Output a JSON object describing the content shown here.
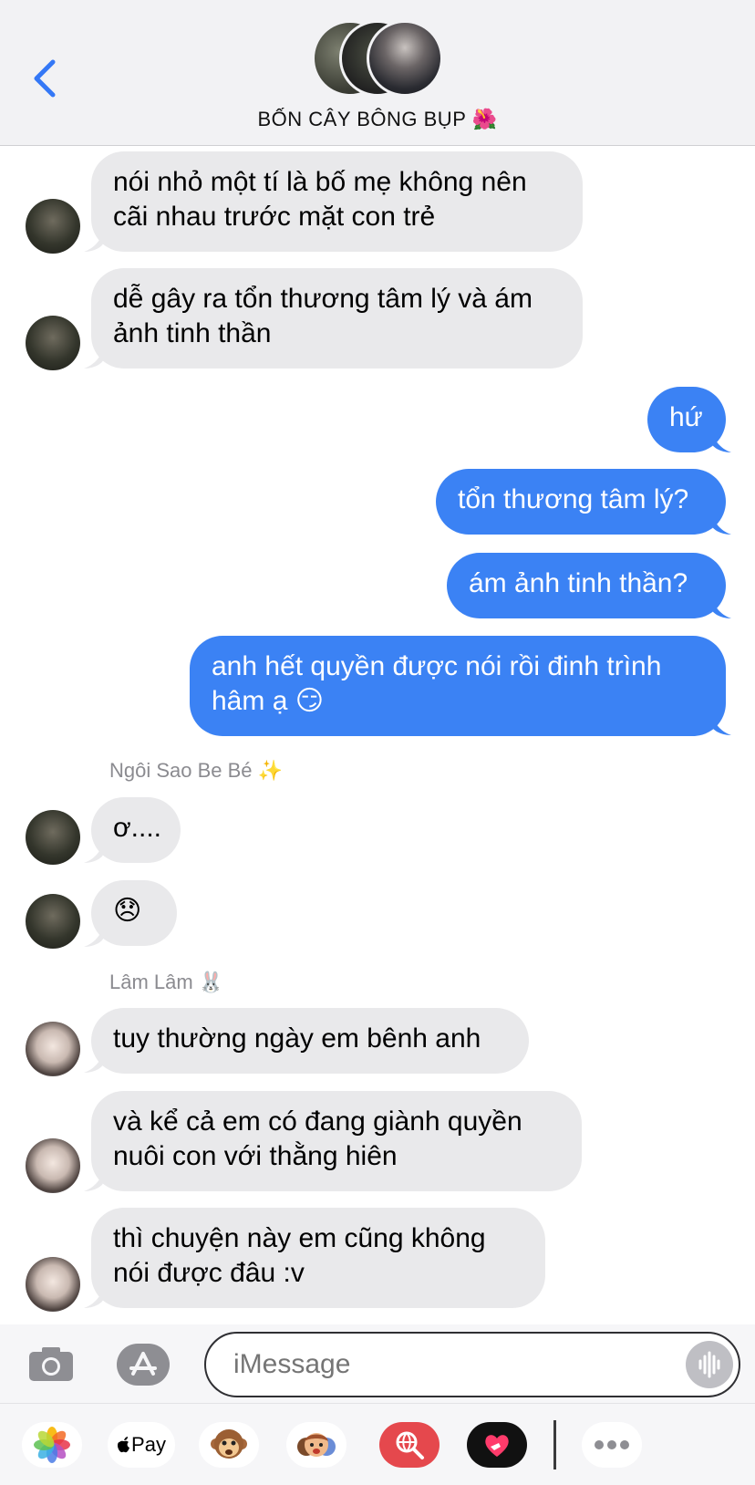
{
  "header": {
    "title": "BỐN CÂY BÔNG BỤP 🌺"
  },
  "messages": [
    {
      "side": "in",
      "text": "nói nhỏ một tí là bố mẹ không nên\ncãi nhau trước mặt con trẻ"
    },
    {
      "side": "in",
      "text": "dễ gây ra tổn thương tâm lý và ám\nảnh tinh thần"
    },
    {
      "side": "out",
      "text": "hứ"
    },
    {
      "side": "out",
      "text": "tổn thương tâm lý?"
    },
    {
      "side": "out",
      "text": "ám ảnh tinh thần?"
    },
    {
      "side": "out",
      "text": "anh hết quyền được nói rồi đinh trình\nhâm ạ 😏"
    },
    {
      "side": "in",
      "sender": "Ngôi Sao Be Bé ✨",
      "text": "ơ...."
    },
    {
      "side": "in",
      "text": "😞"
    },
    {
      "side": "in",
      "sender": "Lâm Lâm 🐰",
      "text": "tuy thường ngày em bênh anh"
    },
    {
      "side": "in",
      "text": "và kể cả em có đang giành quyền\nnuôi con với thằng hiên"
    },
    {
      "side": "in",
      "text": "thì chuyện này em cũng không\nnói được đâu :v"
    }
  ],
  "input": {
    "placeholder": "iMessage"
  },
  "drawer": {
    "pay_label": "Pay"
  },
  "colors": {
    "outgoing": "#3b82f4",
    "incoming": "#e9e9eb",
    "accent": "#3478f6"
  }
}
